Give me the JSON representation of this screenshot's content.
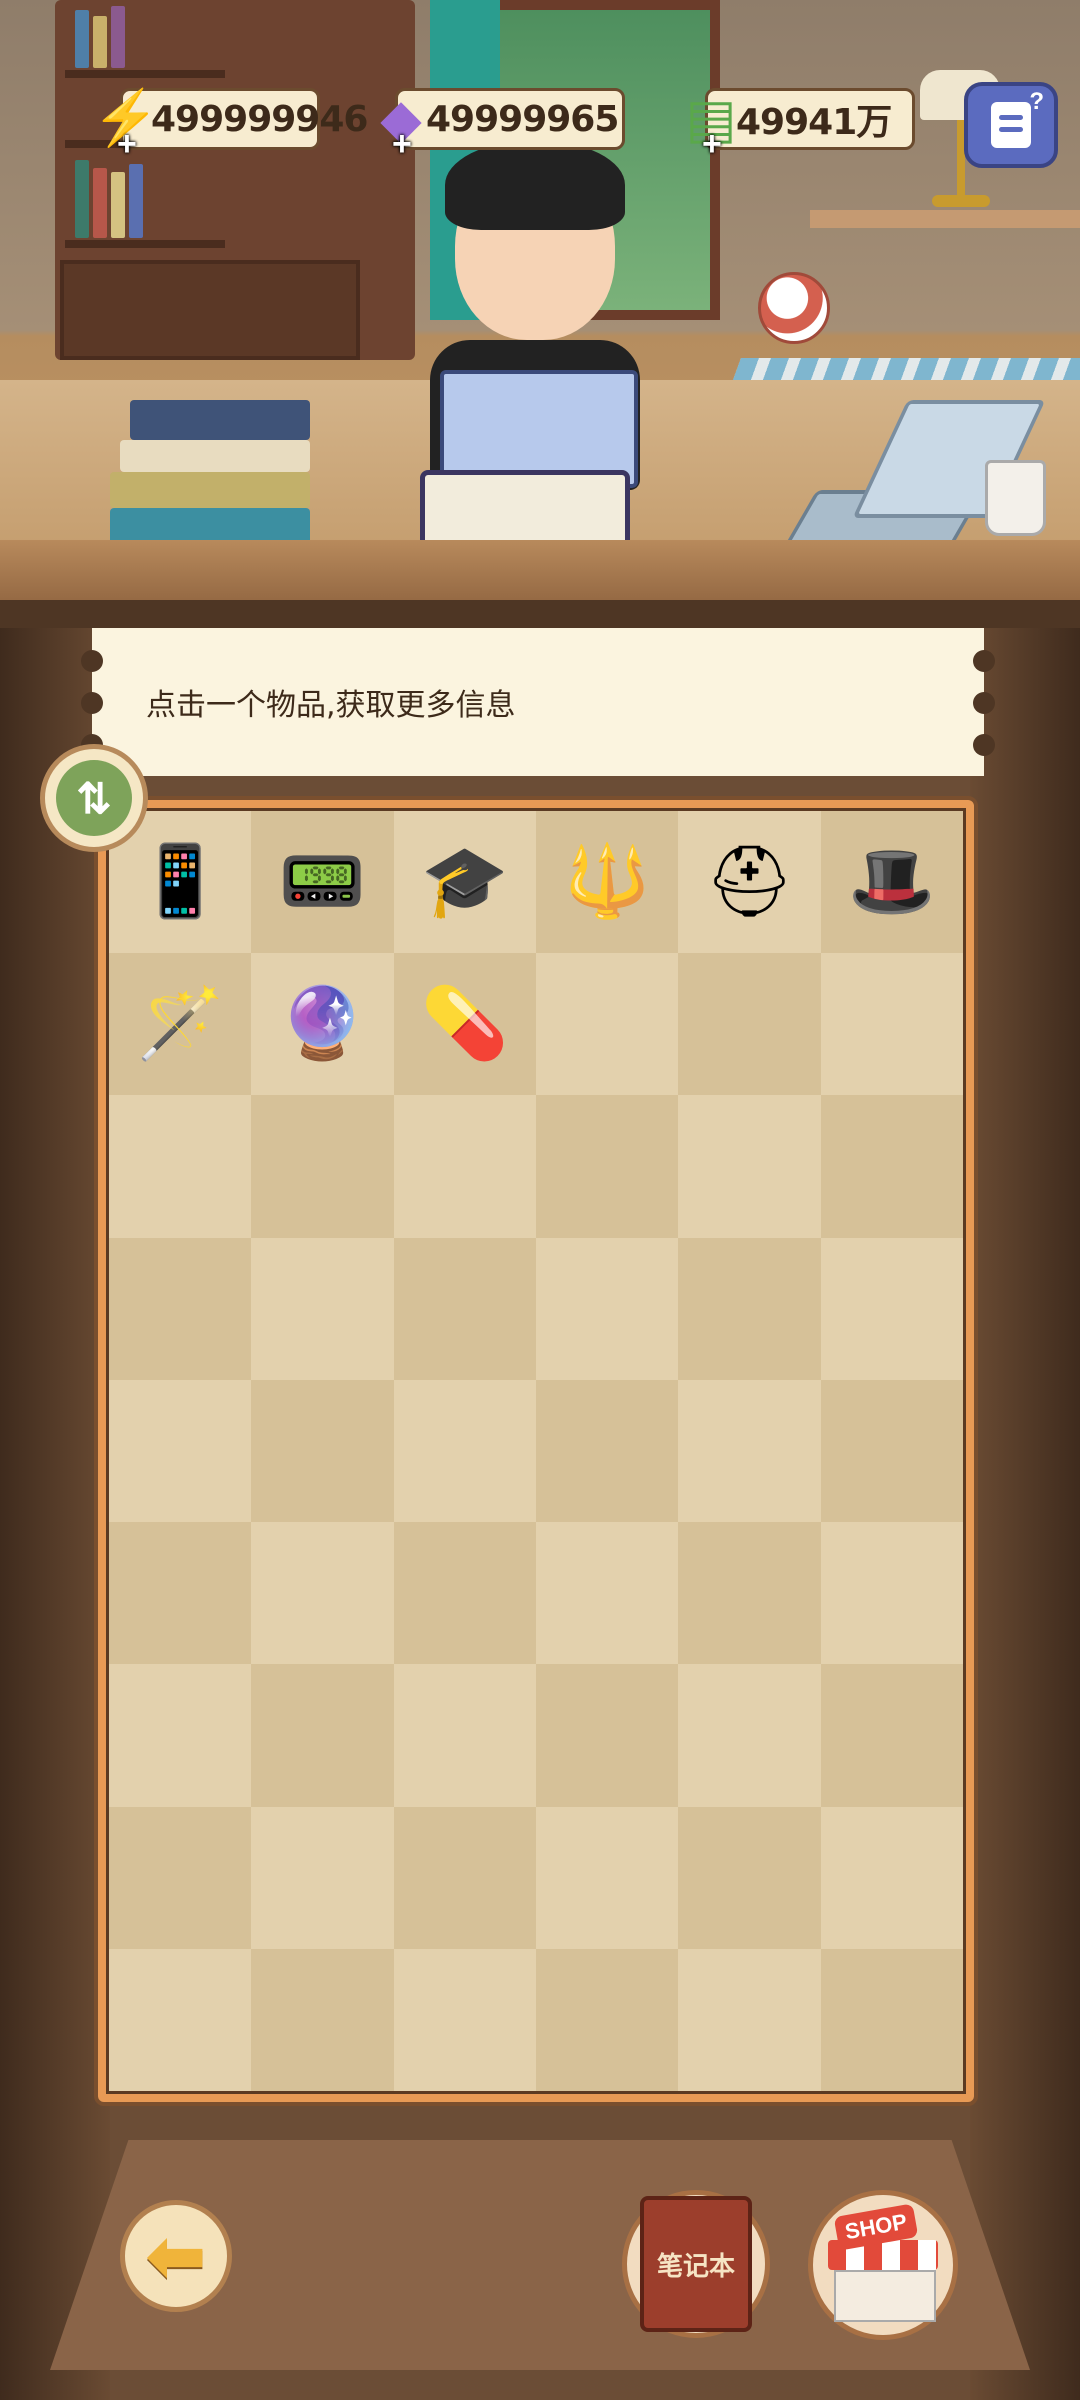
{
  "currency": {
    "energy": {
      "value": "499999946",
      "icon": "lightning-icon"
    },
    "gem": {
      "value": "49999965",
      "icon": "gem-icon"
    },
    "cash": {
      "value": "49941万",
      "icon": "cash-icon"
    },
    "add_symbol": "+"
  },
  "help_button": {
    "icon": "help-document-icon",
    "symbol": "?"
  },
  "banner": {
    "text": "点击一个物品,获取更多信息"
  },
  "sort_button": {
    "icon": "sort-arrows-icon",
    "symbol": "⇅"
  },
  "inventory": {
    "columns": 6,
    "rows": 9,
    "items": [
      {
        "name": "flip-phone",
        "glyph": "📱"
      },
      {
        "name": "tablet",
        "glyph": "📟"
      },
      {
        "name": "graduation-cap",
        "glyph": "🎓"
      },
      {
        "name": "golden-staff",
        "glyph": "🔱"
      },
      {
        "name": "gladiator-helmet",
        "glyph": "⛑"
      },
      {
        "name": "wizard-hat",
        "glyph": "🎩"
      },
      {
        "name": "magic-scepter",
        "glyph": "🪄"
      },
      {
        "name": "crystal-orb",
        "glyph": "🔮"
      },
      {
        "name": "energy-capsule",
        "glyph": "💊"
      }
    ]
  },
  "bottom": {
    "back_symbol": "⬅",
    "notebook_label": "笔记本",
    "shop_label": "SHOP"
  },
  "colors": {
    "banner_bg": "#fbf4df",
    "grid_frame": "#e89a55",
    "cell_light": "#e3d1ad",
    "cell_dark": "#d6c198",
    "wood_dark": "#4e3624"
  }
}
